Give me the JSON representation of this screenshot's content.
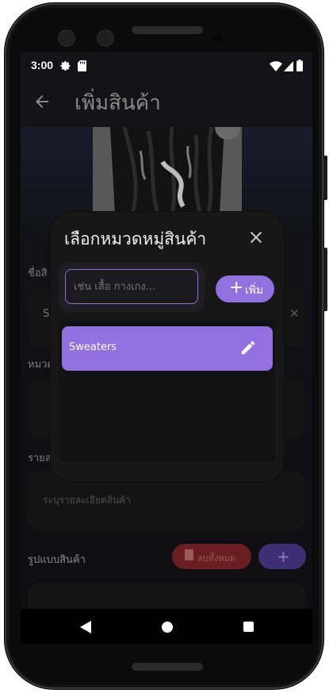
{
  "status_bar": {
    "time": "3:00"
  },
  "app_bar": {
    "title": "เพิ่มสินค้า"
  },
  "form": {
    "name_label": "ชื่อสิ",
    "name_value_initial": "S",
    "category_label": "หมวด",
    "detail_label": "รายล",
    "detail_placeholder": "ระบุรายละเอียดสินค้า",
    "style_label": "รูปแบบสินค้า",
    "delete_all_label": "ลบทั้งหมด"
  },
  "dialog": {
    "title": "เลือกหมวดหมู่สินค้า",
    "search_placeholder": "เช่น เสื้อ กางเกง...",
    "add_label": "เพิ่ม",
    "categories": [
      {
        "label": "Sweaters"
      }
    ]
  },
  "colors": {
    "accent": "#9270e0",
    "danger": "#6a1e22",
    "background": "#141418"
  }
}
